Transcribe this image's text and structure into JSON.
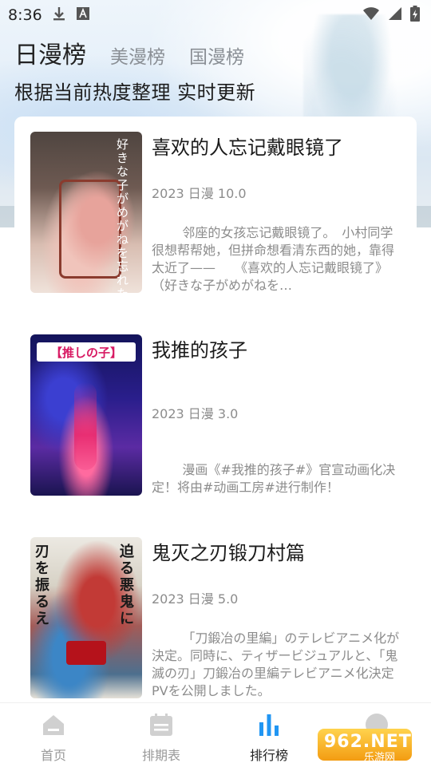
{
  "status_bar": {
    "time": "8:36",
    "icons": [
      "download-icon",
      "a-keyboard-icon",
      "wifi-icon",
      "signal-icon",
      "battery-charging-icon"
    ]
  },
  "tabs": [
    {
      "label": "日漫榜",
      "active": true
    },
    {
      "label": "美漫榜",
      "active": false
    },
    {
      "label": "国漫榜",
      "active": false
    }
  ],
  "subtitle": "根据当前热度整理 实时更新",
  "items": [
    {
      "title": "喜欢的人忘记戴眼镜了",
      "meta": "2023 日漫 10.0",
      "desc": "邻座的女孩忘记戴眼镜了。　小村同学很想帮帮她，但拼命想看清东西的她，靠得太近了——　　《喜欢的人忘记戴眼镜了》（好きな子がめがねを…",
      "cover_text": "好きな子がめがねを忘れた"
    },
    {
      "title": "我推的孩子",
      "meta": "2023 日漫 3.0",
      "desc": "漫画《#我推的孩子#》官宣动画化决定！将由#动画工房#进行制作！",
      "cover_text": "【推しの子】"
    },
    {
      "title": "鬼灭之刃锻刀村篇",
      "meta": "2023 日漫 5.0",
      "desc": "「刀鍛冶の里編」のテレビアニメ化が決定。同時に、ティザービジュアルと、「鬼滅の刃」刀鍛冶の里編テレビアニメ化決定 PVを公開しました。",
      "cover_text_left": "刃を振るえ",
      "cover_text_right": "迫る悪鬼に"
    }
  ],
  "bottom_nav": [
    {
      "label": "首页",
      "icon": "home-icon",
      "active": false
    },
    {
      "label": "排期表",
      "icon": "calendar-icon",
      "active": false
    },
    {
      "label": "排行榜",
      "icon": "bar-chart-icon",
      "active": true
    },
    {
      "label": "",
      "icon": "profile-icon",
      "active": false
    }
  ],
  "watermark": {
    "text": "962.NET",
    "sub": "乐游网"
  },
  "colors": {
    "accent": "#2196f3",
    "active_text": "#222222",
    "inactive_text": "#9a9a9a"
  }
}
